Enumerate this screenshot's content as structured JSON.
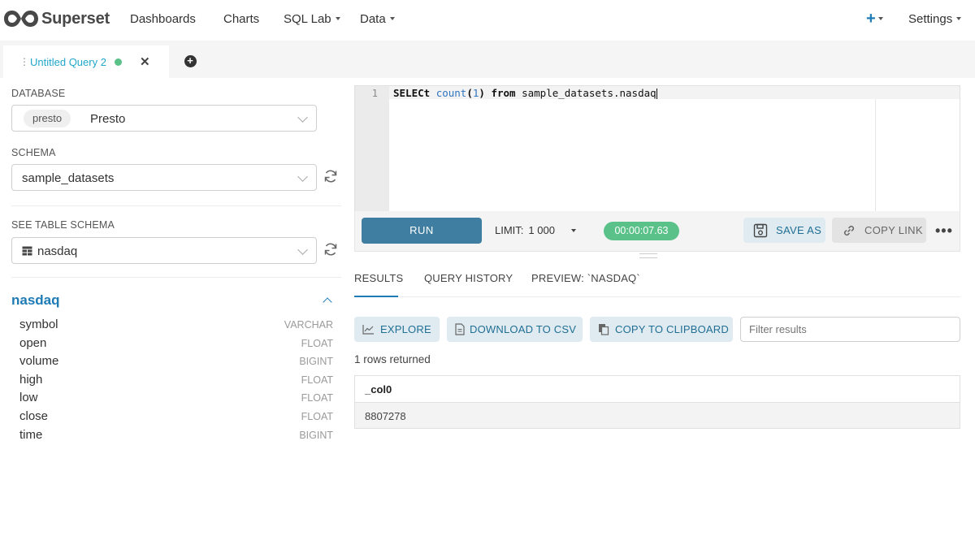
{
  "app": {
    "brand": "Superset"
  },
  "nav": {
    "items": [
      "Dashboards",
      "Charts",
      "SQL Lab",
      "Data"
    ],
    "settings": "Settings",
    "plus": "+"
  },
  "tabs": {
    "query_tab_title": "Untitled Query 2",
    "status_color": "#5ac189"
  },
  "left": {
    "database_label": "DATABASE",
    "database_badge": "presto",
    "database_value": "Presto",
    "schema_label": "SCHEMA",
    "schema_value": "sample_datasets",
    "table_label": "SEE TABLE SCHEMA",
    "table_value": "nasdaq",
    "table_name": "nasdaq",
    "columns": [
      {
        "name": "symbol",
        "type": "VARCHAR"
      },
      {
        "name": "open",
        "type": "FLOAT"
      },
      {
        "name": "volume",
        "type": "BIGINT"
      },
      {
        "name": "high",
        "type": "FLOAT"
      },
      {
        "name": "low",
        "type": "FLOAT"
      },
      {
        "name": "close",
        "type": "FLOAT"
      },
      {
        "name": "time",
        "type": "BIGINT"
      }
    ]
  },
  "editor": {
    "line_number": "1",
    "tokens": {
      "select": "SELECt",
      "func": "count",
      "open_paren": "(",
      "arg": "1",
      "close_paren": ")",
      "from": "from",
      "table": "sample_datasets.nasdaq"
    }
  },
  "toolbar": {
    "run": "RUN",
    "limit_label": "LIMIT:",
    "limit_value": "1 000",
    "timer": "00:00:07.63",
    "save_as": "SAVE AS",
    "copy_link": "COPY LINK"
  },
  "results": {
    "tabs": [
      "RESULTS",
      "QUERY HISTORY",
      "PREVIEW: `NASDAQ`"
    ],
    "explore": "EXPLORE",
    "download_csv": "DOWNLOAD TO CSV",
    "copy_clipboard": "COPY TO CLIPBOARD",
    "filter_placeholder": "Filter results",
    "rows_returned": "1 rows returned",
    "column_header": "_col0",
    "cell_value": "8807278"
  }
}
